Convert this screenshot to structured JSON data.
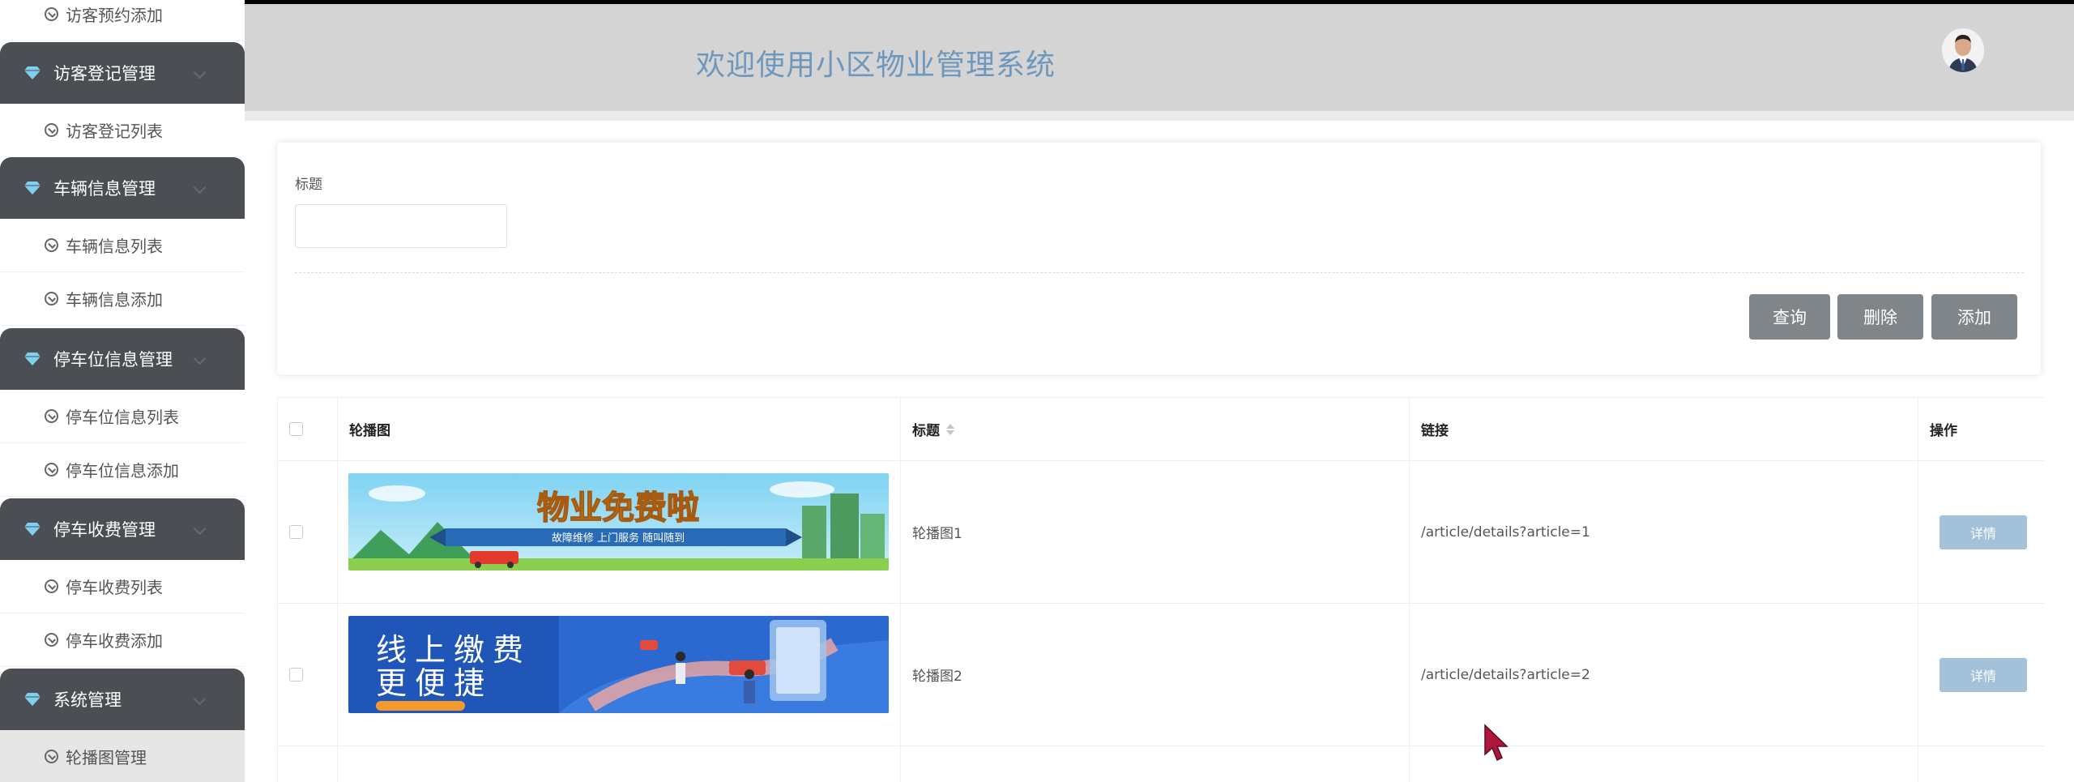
{
  "sidebar": {
    "items": [
      {
        "type": "sub",
        "label": "访客预约添加"
      },
      {
        "type": "group",
        "label": "访客登记管理"
      },
      {
        "type": "sub",
        "label": "访客登记列表"
      },
      {
        "type": "group",
        "label": "车辆信息管理"
      },
      {
        "type": "sub",
        "label": "车辆信息列表"
      },
      {
        "type": "sub",
        "label": "车辆信息添加"
      },
      {
        "type": "group",
        "label": "停车位信息管理"
      },
      {
        "type": "sub",
        "label": "停车位信息列表"
      },
      {
        "type": "sub",
        "label": "停车位信息添加"
      },
      {
        "type": "group",
        "label": "停车收费管理"
      },
      {
        "type": "sub",
        "label": "停车收费列表"
      },
      {
        "type": "sub",
        "label": "停车收费添加"
      },
      {
        "type": "group",
        "label": "系统管理"
      },
      {
        "type": "sub",
        "label": "轮播图管理",
        "active": true
      }
    ]
  },
  "header": {
    "title": "欢迎使用小区物业管理系统",
    "avatar": "user-avatar"
  },
  "search": {
    "title_label": "标题",
    "title_value": "",
    "buttons": {
      "query": "查询",
      "delete": "删除",
      "add": "添加"
    }
  },
  "table": {
    "columns": {
      "image": "轮播图",
      "title": "标题",
      "link": "链接",
      "action": "操作"
    },
    "rows": [
      {
        "banner_main": "物业免费啦",
        "banner_sub": "故障维修  上门服务  随叫随到",
        "title": "轮播图1",
        "link": "/article/details?article=1",
        "action": "详情"
      },
      {
        "banner_main_1": "线上缴费",
        "banner_main_2": "更便捷",
        "title": "轮播图2",
        "link": "/article/details?article=2",
        "action": "详情"
      }
    ]
  },
  "colors": {
    "sidebar_group": "#4b4f54",
    "header_bg": "#d4d4d4",
    "title_blue": "#6e97bd",
    "button_gray": "#7f8589",
    "detail_button": "#a3c2da",
    "cursor": "#b0153c"
  }
}
